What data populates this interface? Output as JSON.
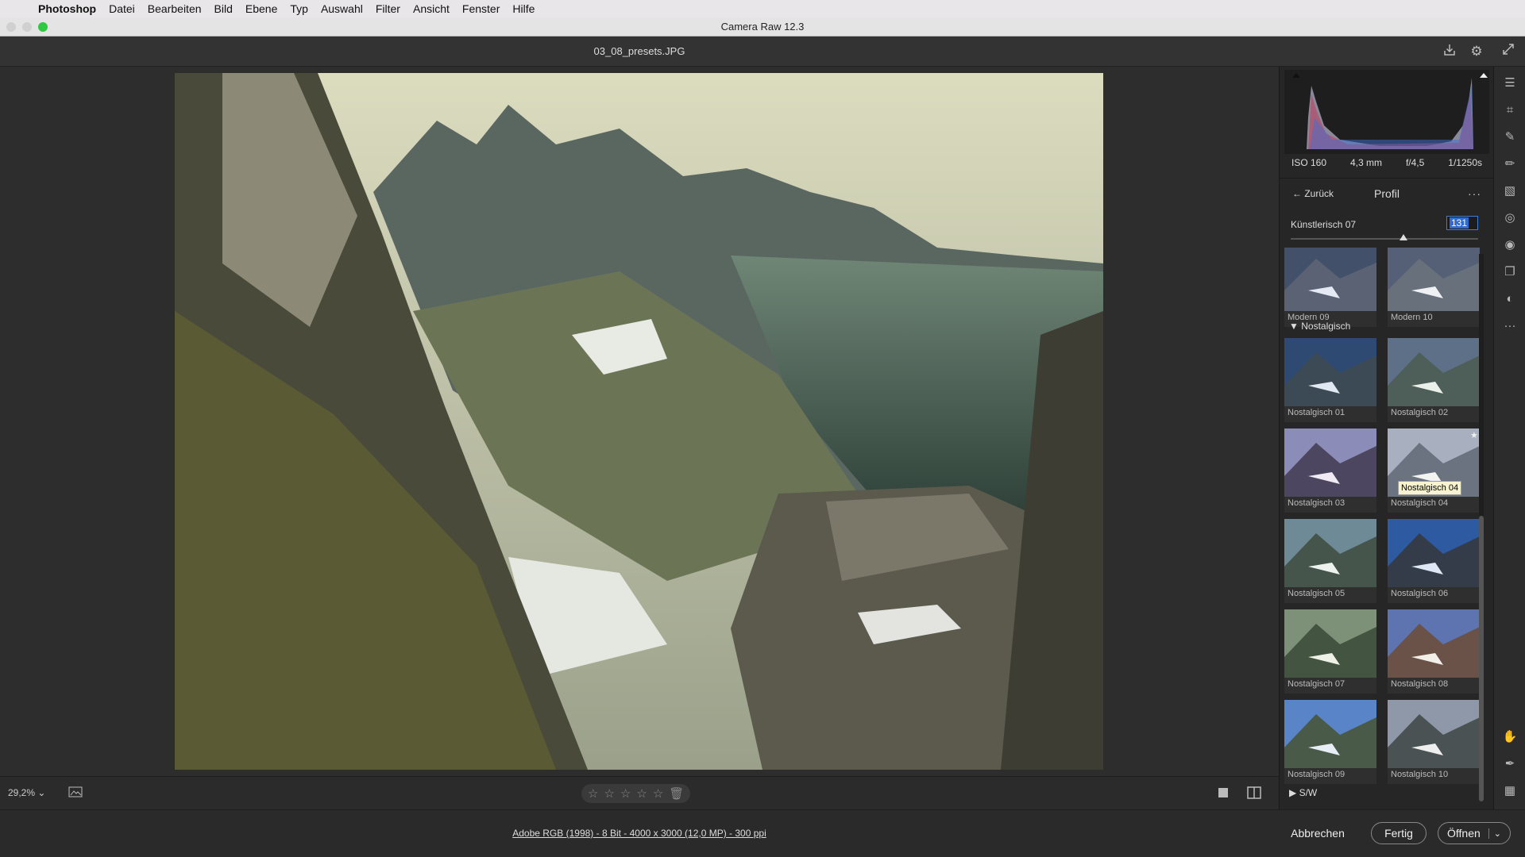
{
  "menubar": {
    "app": "Photoshop",
    "items": [
      "Datei",
      "Bearbeiten",
      "Bild",
      "Ebene",
      "Typ",
      "Auswahl",
      "Filter",
      "Ansicht",
      "Fenster",
      "Hilfe"
    ]
  },
  "window": {
    "title": "Camera Raw 12.3"
  },
  "file": {
    "name": "03_08_presets.JPG"
  },
  "exif": {
    "iso": "ISO 160",
    "focal": "4,3 mm",
    "aperture": "f/4,5",
    "shutter": "1/1250s"
  },
  "profile": {
    "back_label": "Zurück",
    "title": "Profil",
    "more": "···",
    "amount_label": "Künstlerisch 07",
    "amount_value": "131",
    "amount_fraction": 0.6
  },
  "thumbs": {
    "top_row": [
      "Modern 09",
      "Modern 10"
    ],
    "section_nostalgic": "Nostalgisch",
    "nostalgic": [
      "Nostalgisch 01",
      "Nostalgisch 02",
      "Nostalgisch 03",
      "Nostalgisch 04",
      "Nostalgisch 05",
      "Nostalgisch 06",
      "Nostalgisch 07",
      "Nostalgisch 08",
      "Nostalgisch 09",
      "Nostalgisch 10"
    ],
    "section_bw": "S/W",
    "tooltip": "Nostalgisch 04"
  },
  "bottom": {
    "zoom": "29,2%"
  },
  "footer": {
    "workflow": "Adobe RGB (1998) - 8 Bit - 4000 x 3000 (12,0 MP) - 300 ppi",
    "cancel": "Abbrechen",
    "done": "Fertig",
    "open": "Öffnen"
  },
  "colors": {
    "accent": "#2e6cd1",
    "panel": "#262626",
    "tooltip": "#f7f3cf"
  }
}
